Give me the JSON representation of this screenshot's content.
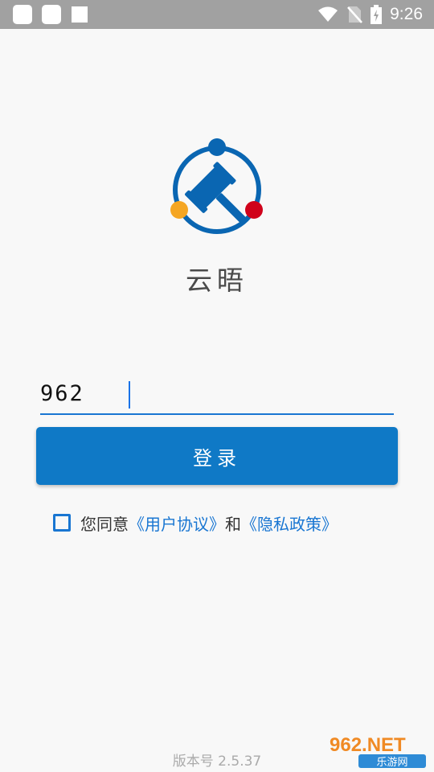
{
  "status_bar": {
    "time": "9:26"
  },
  "app": {
    "name": "云晤"
  },
  "login": {
    "input_value": "962",
    "button_label": "登录"
  },
  "agreement": {
    "prefix": "您同意",
    "user_agreement": "《用户协议》",
    "and": "和",
    "privacy_policy": "《隐私政策》",
    "checked": false
  },
  "footer": {
    "version": "版本号 2.5.37"
  },
  "watermark": {
    "text_top": "962.NET",
    "text_bottom": "乐游网"
  },
  "colors": {
    "accent": "#0f79c6",
    "logo_blue": "#0a66b2",
    "logo_orange": "#f5a623",
    "logo_red": "#d0021b"
  }
}
